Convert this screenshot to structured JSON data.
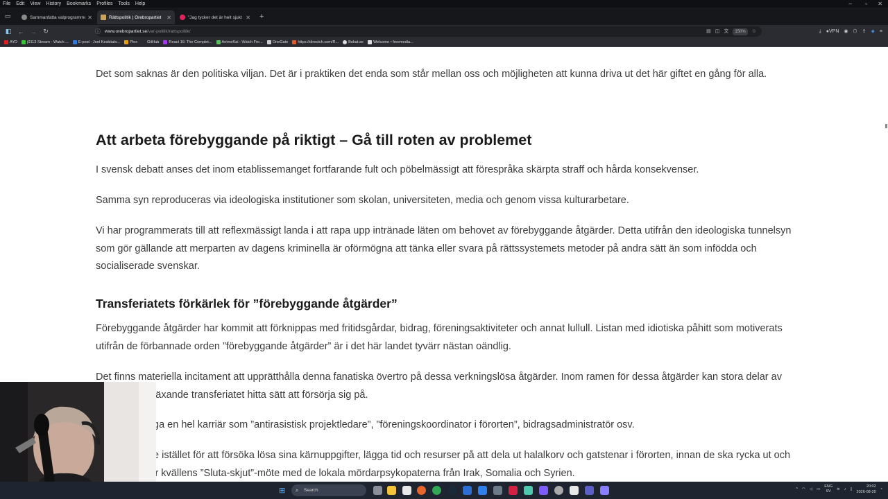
{
  "menu": [
    "File",
    "Edit",
    "View",
    "History",
    "Bookmarks",
    "Profiles",
    "Tools",
    "Help"
  ],
  "tabs": [
    {
      "title": "Sammanfatta valprogrammet",
      "active": false,
      "favicon": "#8a8a8a"
    },
    {
      "title": "Rättspolitik | Örebropartiet",
      "active": true,
      "favicon": "#c9a25b"
    },
    {
      "title": "\"Jag tycker det är helt sjukt att",
      "active": false,
      "favicon": "#e0245e"
    }
  ],
  "address": {
    "domain": "www.orebropartiet.se",
    "path": "/var-politik/rattspolitik/",
    "zoom": "150%",
    "vpn": "VPN"
  },
  "bookmarks": [
    {
      "label": "AYD",
      "color": "#e02020"
    },
    {
      "label": "j0113 Stream - Watch ...",
      "color": "#32c832"
    },
    {
      "label": "E-post - Joel Keskitalo...",
      "color": "#2d7be0"
    },
    {
      "label": "Plex",
      "color": "#e5a00d"
    },
    {
      "label": "GitHub",
      "color": "#dddddd"
    },
    {
      "label": "React 16: The Complet...",
      "color": "#a435f0"
    },
    {
      "label": "AnimeKai - Watch Fre...",
      "color": "#5ac15a"
    },
    {
      "label": "OneGate",
      "color": "#cccccc"
    },
    {
      "label": "https://directch.com/R...",
      "color": "#e05a2a"
    },
    {
      "label": "Bokat.se",
      "color": "#dddddd"
    },
    {
      "label": "Welcome • freemedia...",
      "color": "#dddddd"
    }
  ],
  "article": {
    "p_top": "Det som saknas är den politiska viljan. Det är i praktiken det enda som står mellan oss och möjligheten att kunna driva ut det här giftet en gång för alla.",
    "h2": "Att arbeta förebyggande på riktigt – Gå till roten av problemet",
    "p1": "I svensk debatt anses det inom etablissemanget fortfarande fult och pöbelmässigt att förespråka skärpta straff och hårda konsekvenser.",
    "p2": "Samma syn reproduceras via ideologiska institutioner som skolan, universiteten, media och genom vissa kulturarbetare.",
    "p3": "Vi har programmerats till att reflexmässigt landa i att rapa upp intränade läten om behovet av förebyggande åtgärder. Detta utifrån den ideologiska tunnelsyn som gör gällande att merparten av dagens kriminella är oförmögna att tänka eller svara på rättssystemets metoder på andra sätt än som infödda och socialiserade svenskar.",
    "h3": "Transferiatets förkärlek för ”förebyggande åtgärder”",
    "p4": "Förebyggande åtgärder har kommit att förknippas med fritidsgårdar, bidrag, föreningsaktiviteter och annat lullull. Listan med idiotiska påhitt som motiverats utifrån de förbannade orden ”förebyggande åtgärder” är i det här landet tyvärr nästan oändlig.",
    "p5": "Det finns materiella incitament att upprätthålla denna fanatiska övertro på dessa verkningslösa åtgärder. Inom ramen för dessa åtgärder kan stora delar av det ständigt växande transferiatet hitta sätt att försörja sig på.",
    "p6": "Man kan bygga en hel karriär som ”antirasistisk projektledare”, ”föreningskoordinator i förorten”, bidragsadministratör osv.",
    "p7": "Polisen måste istället för att försöka lösa sina kärnuppgifter, lägga tid och resurser på att dela ut halalkorv och gatstenar i förorten, innan de ska rycka ut och köpa pizza för kvällens ”Sluta-skjut”-möte med de lokala mördarpsykopaterna från Irak, Somalia och Syrien."
  },
  "taskbar": {
    "search": "Search",
    "lang": "ENG",
    "lang2": "SV",
    "time": "20:02",
    "date": "2026-08-20"
  }
}
